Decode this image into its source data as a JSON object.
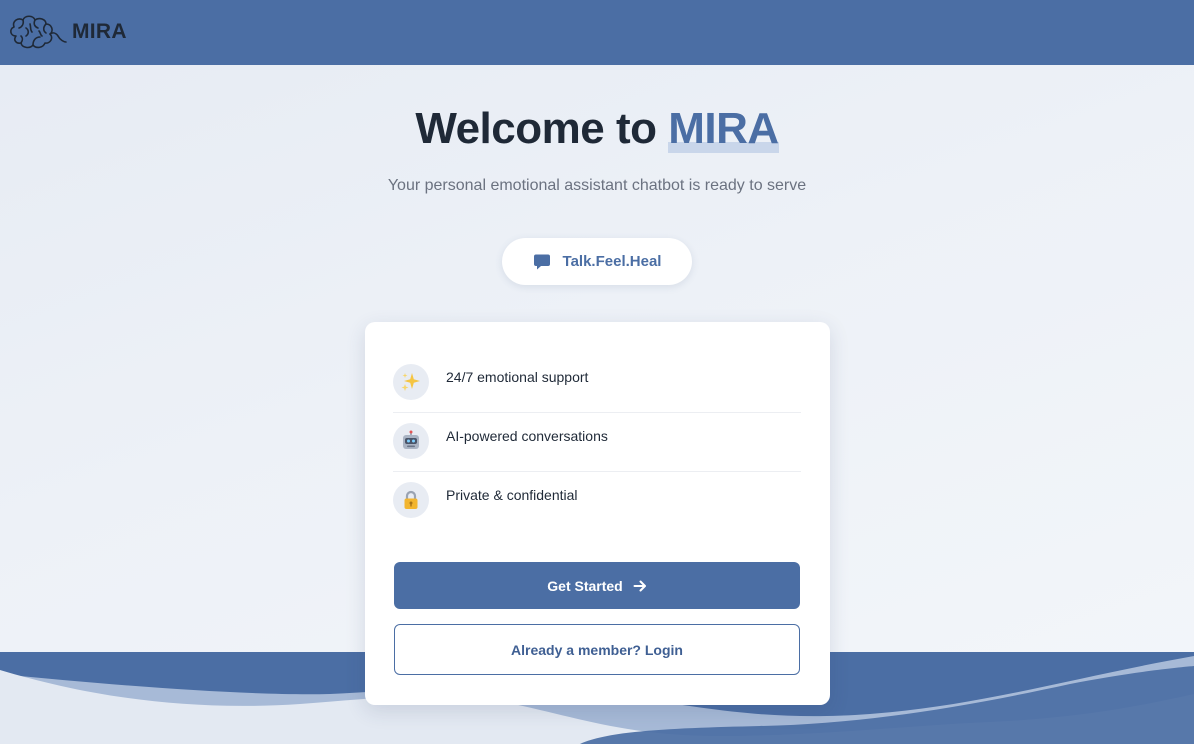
{
  "header": {
    "brand_name": "MIRA",
    "logo_icon": "brain-icon",
    "background_color": "#4b6ea4"
  },
  "hero": {
    "title_prefix": "Welcome to ",
    "title_highlight": "MIRA",
    "subtitle": "Your personal emotional assistant chatbot is ready to serve"
  },
  "tagline": {
    "icon": "chat-bubble-icon",
    "text": "Talk.Feel.Heal"
  },
  "features": [
    {
      "icon": "sparkles-icon",
      "text": "24/7 emotional support"
    },
    {
      "icon": "robot-icon",
      "text": "AI-powered conversations"
    },
    {
      "icon": "lock-icon",
      "text": "Private & confidential"
    }
  ],
  "actions": {
    "get_started_label": "Get Started",
    "get_started_icon": "arrow-right-icon",
    "login_label": "Already a member? Login"
  },
  "colors": {
    "accent": "#4b6ea4",
    "text_dark": "#1f2937",
    "text_muted": "#6b7280",
    "background": "#edf1f7"
  }
}
